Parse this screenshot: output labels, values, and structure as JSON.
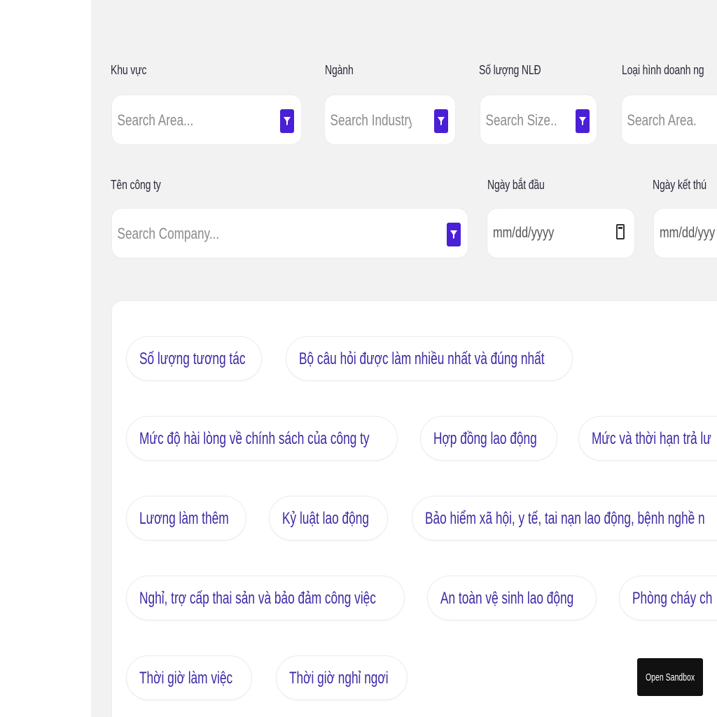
{
  "filters": {
    "area": {
      "label": "Khu vực",
      "placeholder": "Search Area..."
    },
    "industry": {
      "label": "Ngành",
      "placeholder": "Search Industry..."
    },
    "size": {
      "label": "Số lượng NLĐ",
      "placeholder": "Search Size..."
    },
    "business_type": {
      "label": "Loại hình doanh ng",
      "placeholder": "Search Area..."
    },
    "company": {
      "label": "Tên công ty",
      "placeholder": "Search Company..."
    },
    "start_date": {
      "label": "Ngày bắt đầu",
      "value": "mm/dd/yyyy"
    },
    "end_date": {
      "label": "Ngày kết thú",
      "value": "mm/dd/yyy"
    }
  },
  "topics": [
    "Số lượng tương tác",
    "Bộ câu hỏi được làm nhiều nhất và đúng nhất",
    "Mức độ hài lòng về chính sách của công ty",
    "Hợp đồng lao động",
    "Mức và thời hạn trả lư",
    "Lương làm thêm",
    "Kỷ luật lao động",
    "Bảo hiểm xã hội, y tế, tai nạn lao động, bệnh nghề n",
    "Nghỉ, trợ cấp thai sản và bảo đảm công việc",
    "An toàn vệ sinh lao động",
    "Phòng cháy ch",
    "Thời giờ làm việc",
    "Thời giờ nghỉ ngơi"
  ],
  "tooltip": {
    "text": "Open Sandbox"
  },
  "colors": {
    "accent": "#4a1fd6",
    "chip_text": "#3b2aa6",
    "panel_bg": "#f2f2f2"
  }
}
